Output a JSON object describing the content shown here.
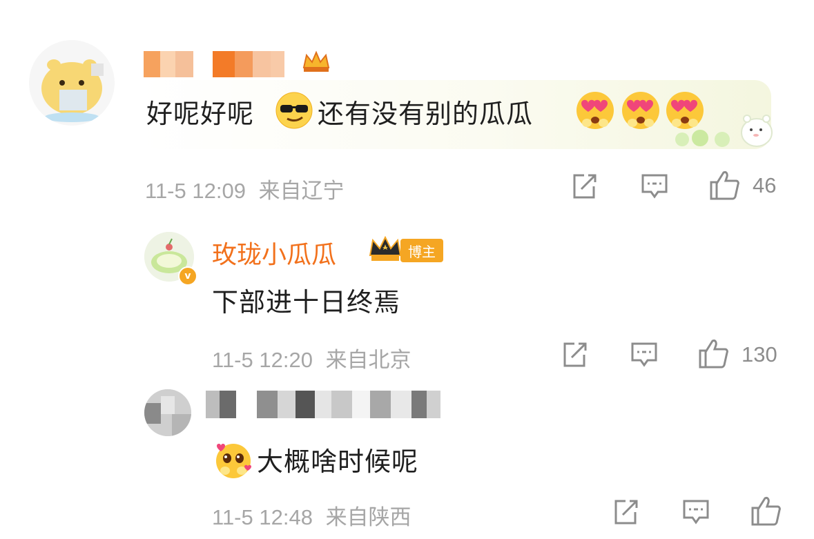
{
  "comments": [
    {
      "text_before": "好呢好呢",
      "text_after": "还有没有别的瓜瓜",
      "time": "11-5 12:09",
      "location": "来自辽宁",
      "likes": "46",
      "emoji_names": [
        "sunglasses-emoji",
        "heart-eyes-emoji",
        "heart-eyes-emoji",
        "heart-eyes-emoji"
      ]
    },
    {
      "username": "玫珑小瓜瓜",
      "author_tag": "博主",
      "text": "下部进十日终焉",
      "time": "11-5 12:20",
      "location": "来自北京",
      "likes": "130",
      "verified_badge": "v"
    },
    {
      "text": "大概啥时候呢",
      "time": "11-5 12:48",
      "location": "来自陕西",
      "emoji_names": [
        "pleading-emoji"
      ]
    }
  ],
  "colors": {
    "username": "#f2711c",
    "meta": "#a6a6a6",
    "text": "#1f1f1f",
    "tag": "#f5a623"
  }
}
